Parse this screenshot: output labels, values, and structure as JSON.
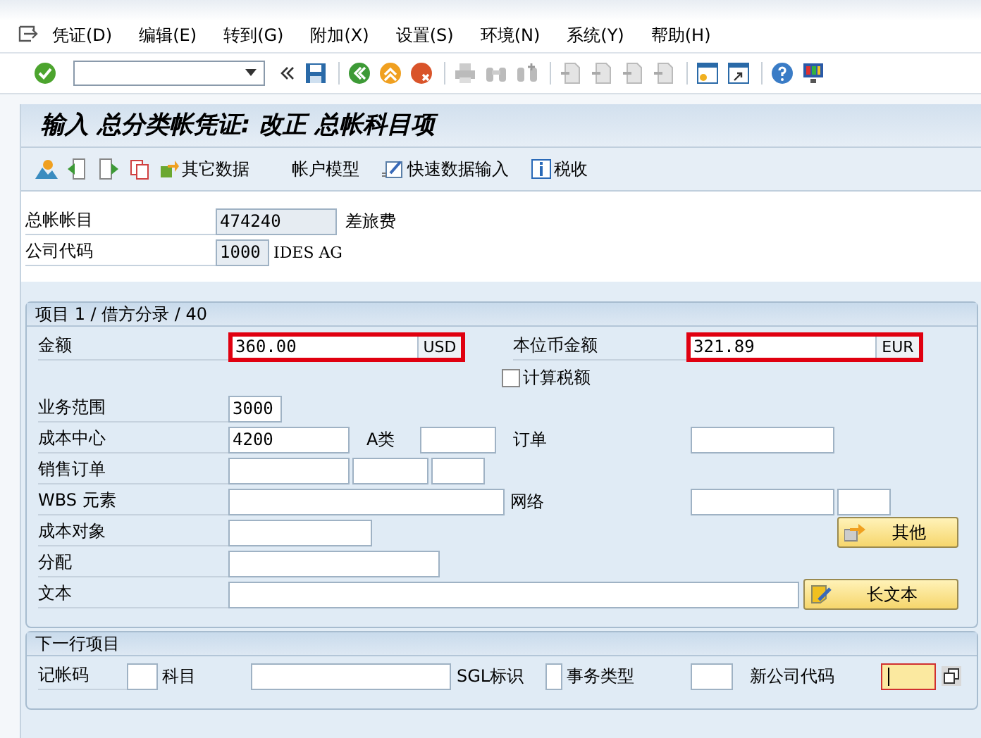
{
  "menu": [
    {
      "label": "凭证(D)"
    },
    {
      "label": "编辑(E)"
    },
    {
      "label": "转到(G)"
    },
    {
      "label": "附加(X)"
    },
    {
      "label": "设置(S)"
    },
    {
      "label": "环境(N)"
    },
    {
      "label": "系统(Y)"
    },
    {
      "label": "帮助(H)"
    }
  ],
  "title": "输入 总分类帐凭证: 改正 总帐科目项",
  "app_toolbar": [
    {
      "kind": "icon_text",
      "label": "其它数据"
    },
    {
      "kind": "text",
      "label": "帐户模型"
    },
    {
      "kind": "icon_text",
      "label": "快速数据输入"
    },
    {
      "kind": "info",
      "label": "税收"
    }
  ],
  "header": {
    "gl_account": {
      "label": "总帐帐目",
      "value": "474240",
      "description": "差旅费",
      "readonly": true
    },
    "company_code": {
      "label": "公司代码",
      "value": "1000",
      "description": "IDES AG",
      "readonly": true
    }
  },
  "item_section": {
    "title": "项目 1 / 借方分录 / 40",
    "amount": {
      "label": "金额",
      "value": "360.00",
      "currency": "USD",
      "highlighted": true
    },
    "local_amount": {
      "label": "本位币金额",
      "value": "321.89",
      "currency": "EUR",
      "highlighted": true
    },
    "calc_tax": {
      "label": "计算税额",
      "checked": false
    },
    "business_area": {
      "label": "业务范围",
      "value": "3000"
    },
    "cost_center": {
      "label": "成本中心",
      "value": "4200"
    },
    "a_class": {
      "label": "A类"
    },
    "order": {
      "label": "订单"
    },
    "sales_order": {
      "label": "销售订单"
    },
    "wbs": {
      "label": "WBS 元素"
    },
    "network": {
      "label": "网络"
    },
    "cost_object": {
      "label": "成本对象"
    },
    "other_button": {
      "label": "其他"
    },
    "assignment": {
      "label": "分配"
    },
    "text": {
      "label": "文本"
    },
    "long_text_button": {
      "label": "长文本"
    }
  },
  "next_item": {
    "title": "下一行项目",
    "posting_key": {
      "label": "记帐码"
    },
    "account": {
      "label": "科目"
    },
    "sgl": {
      "label": "SGL标识"
    },
    "transaction_type": {
      "label": "事务类型"
    },
    "new_company_code": {
      "label": "新公司代码",
      "focused": true
    }
  }
}
